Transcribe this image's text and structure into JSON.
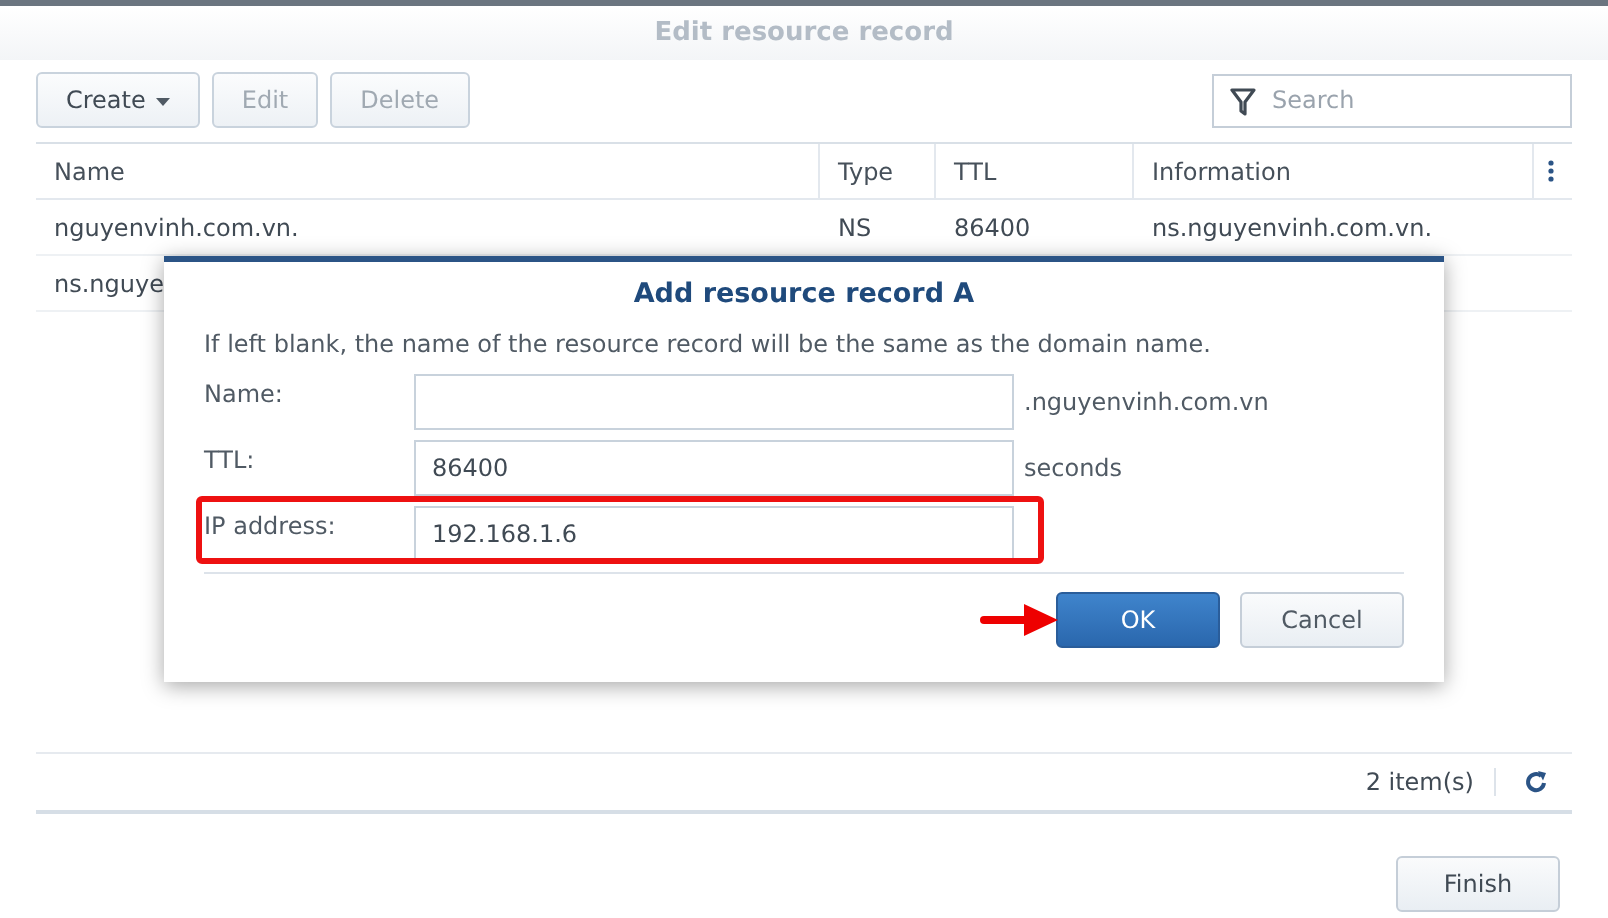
{
  "window": {
    "title": "Edit resource record"
  },
  "toolbar": {
    "buttons": [
      {
        "label": "Create",
        "kind": "dropdown",
        "disabled": false
      },
      {
        "label": "Edit",
        "kind": "plain",
        "disabled": true
      },
      {
        "label": "Delete",
        "kind": "plain",
        "disabled": true
      }
    ],
    "search": {
      "placeholder": "Search"
    }
  },
  "table": {
    "columns": [
      "Name",
      "Type",
      "TTL",
      "Information"
    ],
    "rows": [
      [
        "nguyenvinh.com.vn.",
        "NS",
        "86400",
        "ns.nguyenvinh.com.vn."
      ],
      [
        "ns.nguye"
      ]
    ]
  },
  "status_bar": {
    "count": "2 item(s)"
  },
  "footer": {
    "buttons": [
      "Finish"
    ]
  },
  "dialog": {
    "title": "Add resource record A",
    "description": "If left blank, the name of the resource record will be the same as the domain name.",
    "fields": [
      {
        "label": "Name:",
        "suffix": ".nguyenvinh.com.vn",
        "highlighted": false
      },
      {
        "label": "TTL:",
        "value": "86400",
        "suffix": "seconds",
        "highlighted": false
      },
      {
        "label": "IP address:",
        "value": "192.168.1.6",
        "highlighted": true
      }
    ],
    "buttons": [
      {
        "label": "OK",
        "kind": "primary",
        "pointed": true
      },
      {
        "label": "Cancel",
        "kind": "secondary",
        "pointed": false
      }
    ]
  }
}
